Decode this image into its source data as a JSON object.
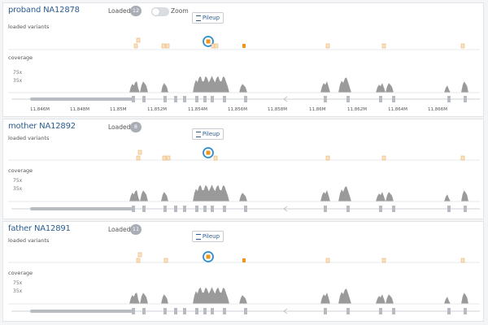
{
  "panels": [
    {
      "sample_name": "proband NA12878",
      "loaded_label": "Loaded",
      "loaded_count": "12",
      "zoom_label": "Zoom",
      "pileup_label": "Pileup",
      "variants_label": "loaded variants",
      "coverage_label": "coverage",
      "y_ticks": [
        "75x",
        "35x"
      ],
      "x_ticks": [
        "11,846M",
        "11,848M",
        "11,85M",
        "11,852M",
        "11,854M",
        "11,856M",
        "11,858M",
        "11,86M",
        "11,862M",
        "11,864M",
        "11,866M"
      ]
    },
    {
      "sample_name": "mother NA12892",
      "loaded_label": "Loaded",
      "loaded_count": "8",
      "pileup_label": "Pileup",
      "variants_label": "loaded variants",
      "coverage_label": "coverage",
      "y_ticks": [
        "75x",
        "35x"
      ]
    },
    {
      "sample_name": "father NA12891",
      "loaded_label": "Loaded",
      "loaded_count": "11",
      "pileup_label": "Pileup",
      "variants_label": "loaded variants",
      "coverage_label": "coverage",
      "y_ticks": [
        "75x",
        "35x"
      ]
    }
  ],
  "colors": {
    "title": "#2b5d8f",
    "variant_fill": "#fbe3c4",
    "variant_stroke": "#e9b06f",
    "variant_selected": "#f0951e",
    "highlight_ring": "#2b8fd0",
    "coverage_fill": "#9a9a9a",
    "gene_line": "#cfd2d6"
  },
  "icons": {
    "pileup": "pileup-icon",
    "highlight": "selected-variant-ring"
  }
}
